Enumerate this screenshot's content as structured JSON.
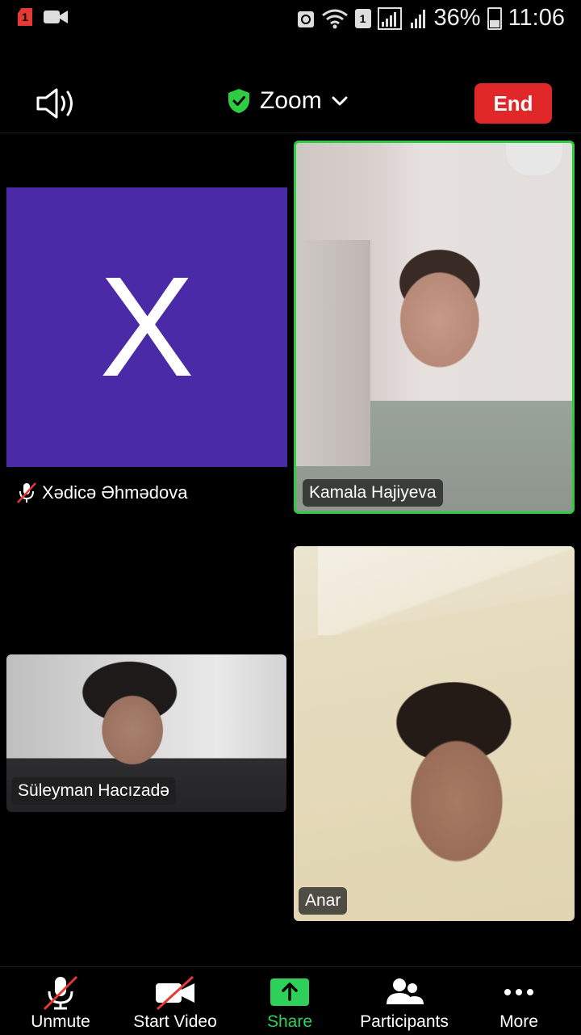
{
  "status_bar": {
    "sim_label": "1",
    "battery": "36%",
    "time": "11:06",
    "sim_slot": "1"
  },
  "meeting": {
    "title": "Zoom",
    "end_label": "End",
    "accent_green": "#2ecc40",
    "end_color": "#e02828"
  },
  "participants": {
    "avatar": {
      "initial": "X",
      "name": "Xədicə Əhmədova",
      "muted": true,
      "color": "#4a2aa6"
    },
    "kamala": {
      "name": "Kamala Hajiyeva",
      "active_speaker": true
    },
    "suleyman": {
      "name": "Süleyman Hacızadə"
    },
    "anar": {
      "name": "Anar"
    }
  },
  "toolbar": {
    "unmute": "Unmute",
    "start_video": "Start Video",
    "share": "Share",
    "participants": "Participants",
    "more": "More",
    "share_color": "#2fd05a"
  }
}
